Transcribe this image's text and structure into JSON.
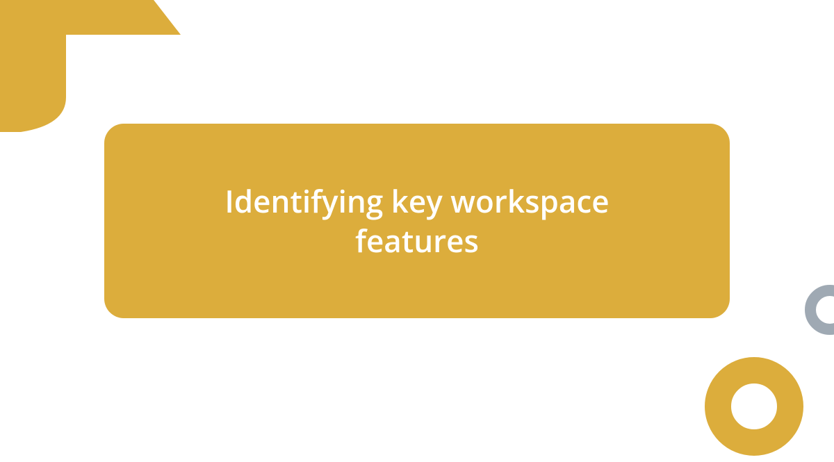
{
  "title": "Identifying key workspace features",
  "colors": {
    "primary": "#dcad3c",
    "secondary": "#9fa9b3",
    "text": "#ffffff",
    "background": "#ffffff"
  }
}
